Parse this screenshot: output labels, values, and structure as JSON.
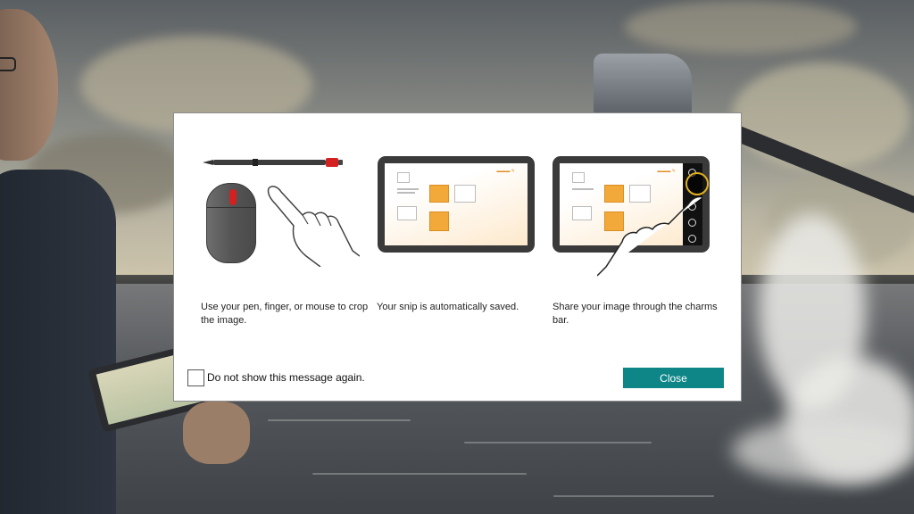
{
  "dialog": {
    "steps": [
      {
        "caption": "Use your pen, finger, or mouse to crop the image."
      },
      {
        "caption": "Your snip is automatically saved."
      },
      {
        "caption": "Share your image through the charms bar."
      }
    ],
    "checkbox_label": "Do not show this message again.",
    "checkbox_checked": false,
    "close_label": "Close"
  },
  "icons": [
    "pen-icon",
    "mouse-icon",
    "finger-icon",
    "tablet-icon",
    "charms-bar-icon",
    "share-charm-icon"
  ],
  "colors": {
    "close_button": "#0e8688",
    "accent_red": "#d32020",
    "highlight_ring": "#e3b020",
    "folder_orange": "#f3a93a"
  }
}
